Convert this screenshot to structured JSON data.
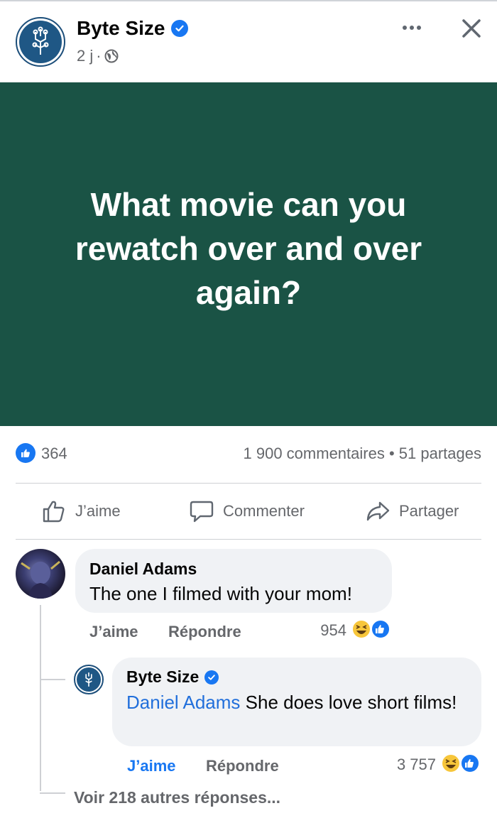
{
  "post": {
    "page_name": "Byte Size",
    "time": "2 j",
    "meta_separator": "·",
    "image_text": "What movie can you rewatch over and over again?"
  },
  "stats": {
    "likes": "364",
    "comments": "1 900 commentaires",
    "separator": "•",
    "shares": "51 partages"
  },
  "actions": {
    "like": "J’aime",
    "comment": "Commenter",
    "share": "Partager"
  },
  "comments": [
    {
      "author": "Daniel Adams",
      "text": "The one I filmed with your mom!",
      "like_label": "J’aime",
      "reply_label": "Répondre",
      "reaction_count": "954",
      "reactions": [
        "haha-icon",
        "like-icon"
      ]
    }
  ],
  "reply": {
    "author": "Byte Size",
    "mention": "Daniel Adams",
    "text": " She does love short films!",
    "like_label": "J’aime",
    "reply_label": "Répondre",
    "reaction_count": "3 757",
    "reactions": [
      "haha-icon",
      "like-icon"
    ]
  },
  "see_more_replies": "Voir 218 autres réponses...",
  "colors": {
    "brand_blue": "#1877f2",
    "post_background": "#1a5345",
    "mention": "#216fdb"
  }
}
